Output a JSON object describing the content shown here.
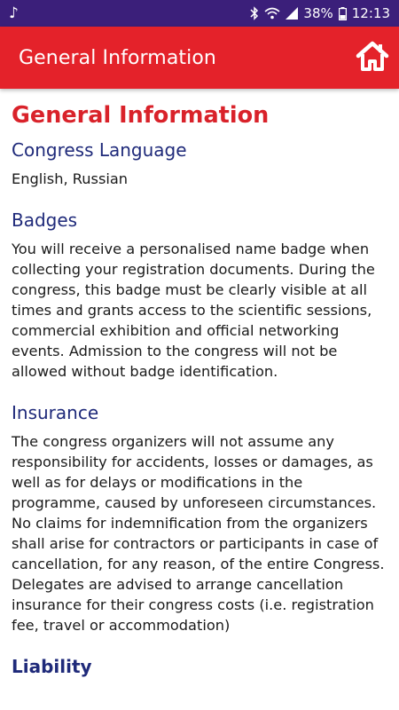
{
  "status_bar": {
    "battery": "38%",
    "time": "12:13"
  },
  "app_bar": {
    "title": "General Information",
    "home_icon": "home-icon"
  },
  "page": {
    "title": "General Information",
    "sections": [
      {
        "title": "Congress Language",
        "paragraphs": [
          "English, Russian"
        ]
      },
      {
        "title": "Badges",
        "paragraphs": [
          "You will receive a personalised name badge when collecting your registration documents. During the congress, this badge must be clearly visible at all times and grants access to the scientific sessions, commercial exhibition and official networking events. Admission to the congress will not be allowed without badge identification."
        ]
      },
      {
        "title": "Insurance",
        "paragraphs": [
          "The congress organizers will not assume any responsibility for accidents, losses or damages, as well as for delays or modifications in the programme, caused by unforeseen circumstances. No claims for indemnification from the organizers shall arise for contractors or participants in case of cancellation, for any reason, of the entire Congress.",
          "Delegates are advised to arrange cancellation insurance for their congress costs (i.e. registration fee, travel or accommodation)"
        ]
      },
      {
        "title": "Liability",
        "paragraphs": []
      }
    ]
  },
  "colors": {
    "status_bar": "#3b1f7a",
    "app_bar": "#e4222a",
    "page_title": "#d9222a",
    "section_title": "#1f2a7a"
  }
}
